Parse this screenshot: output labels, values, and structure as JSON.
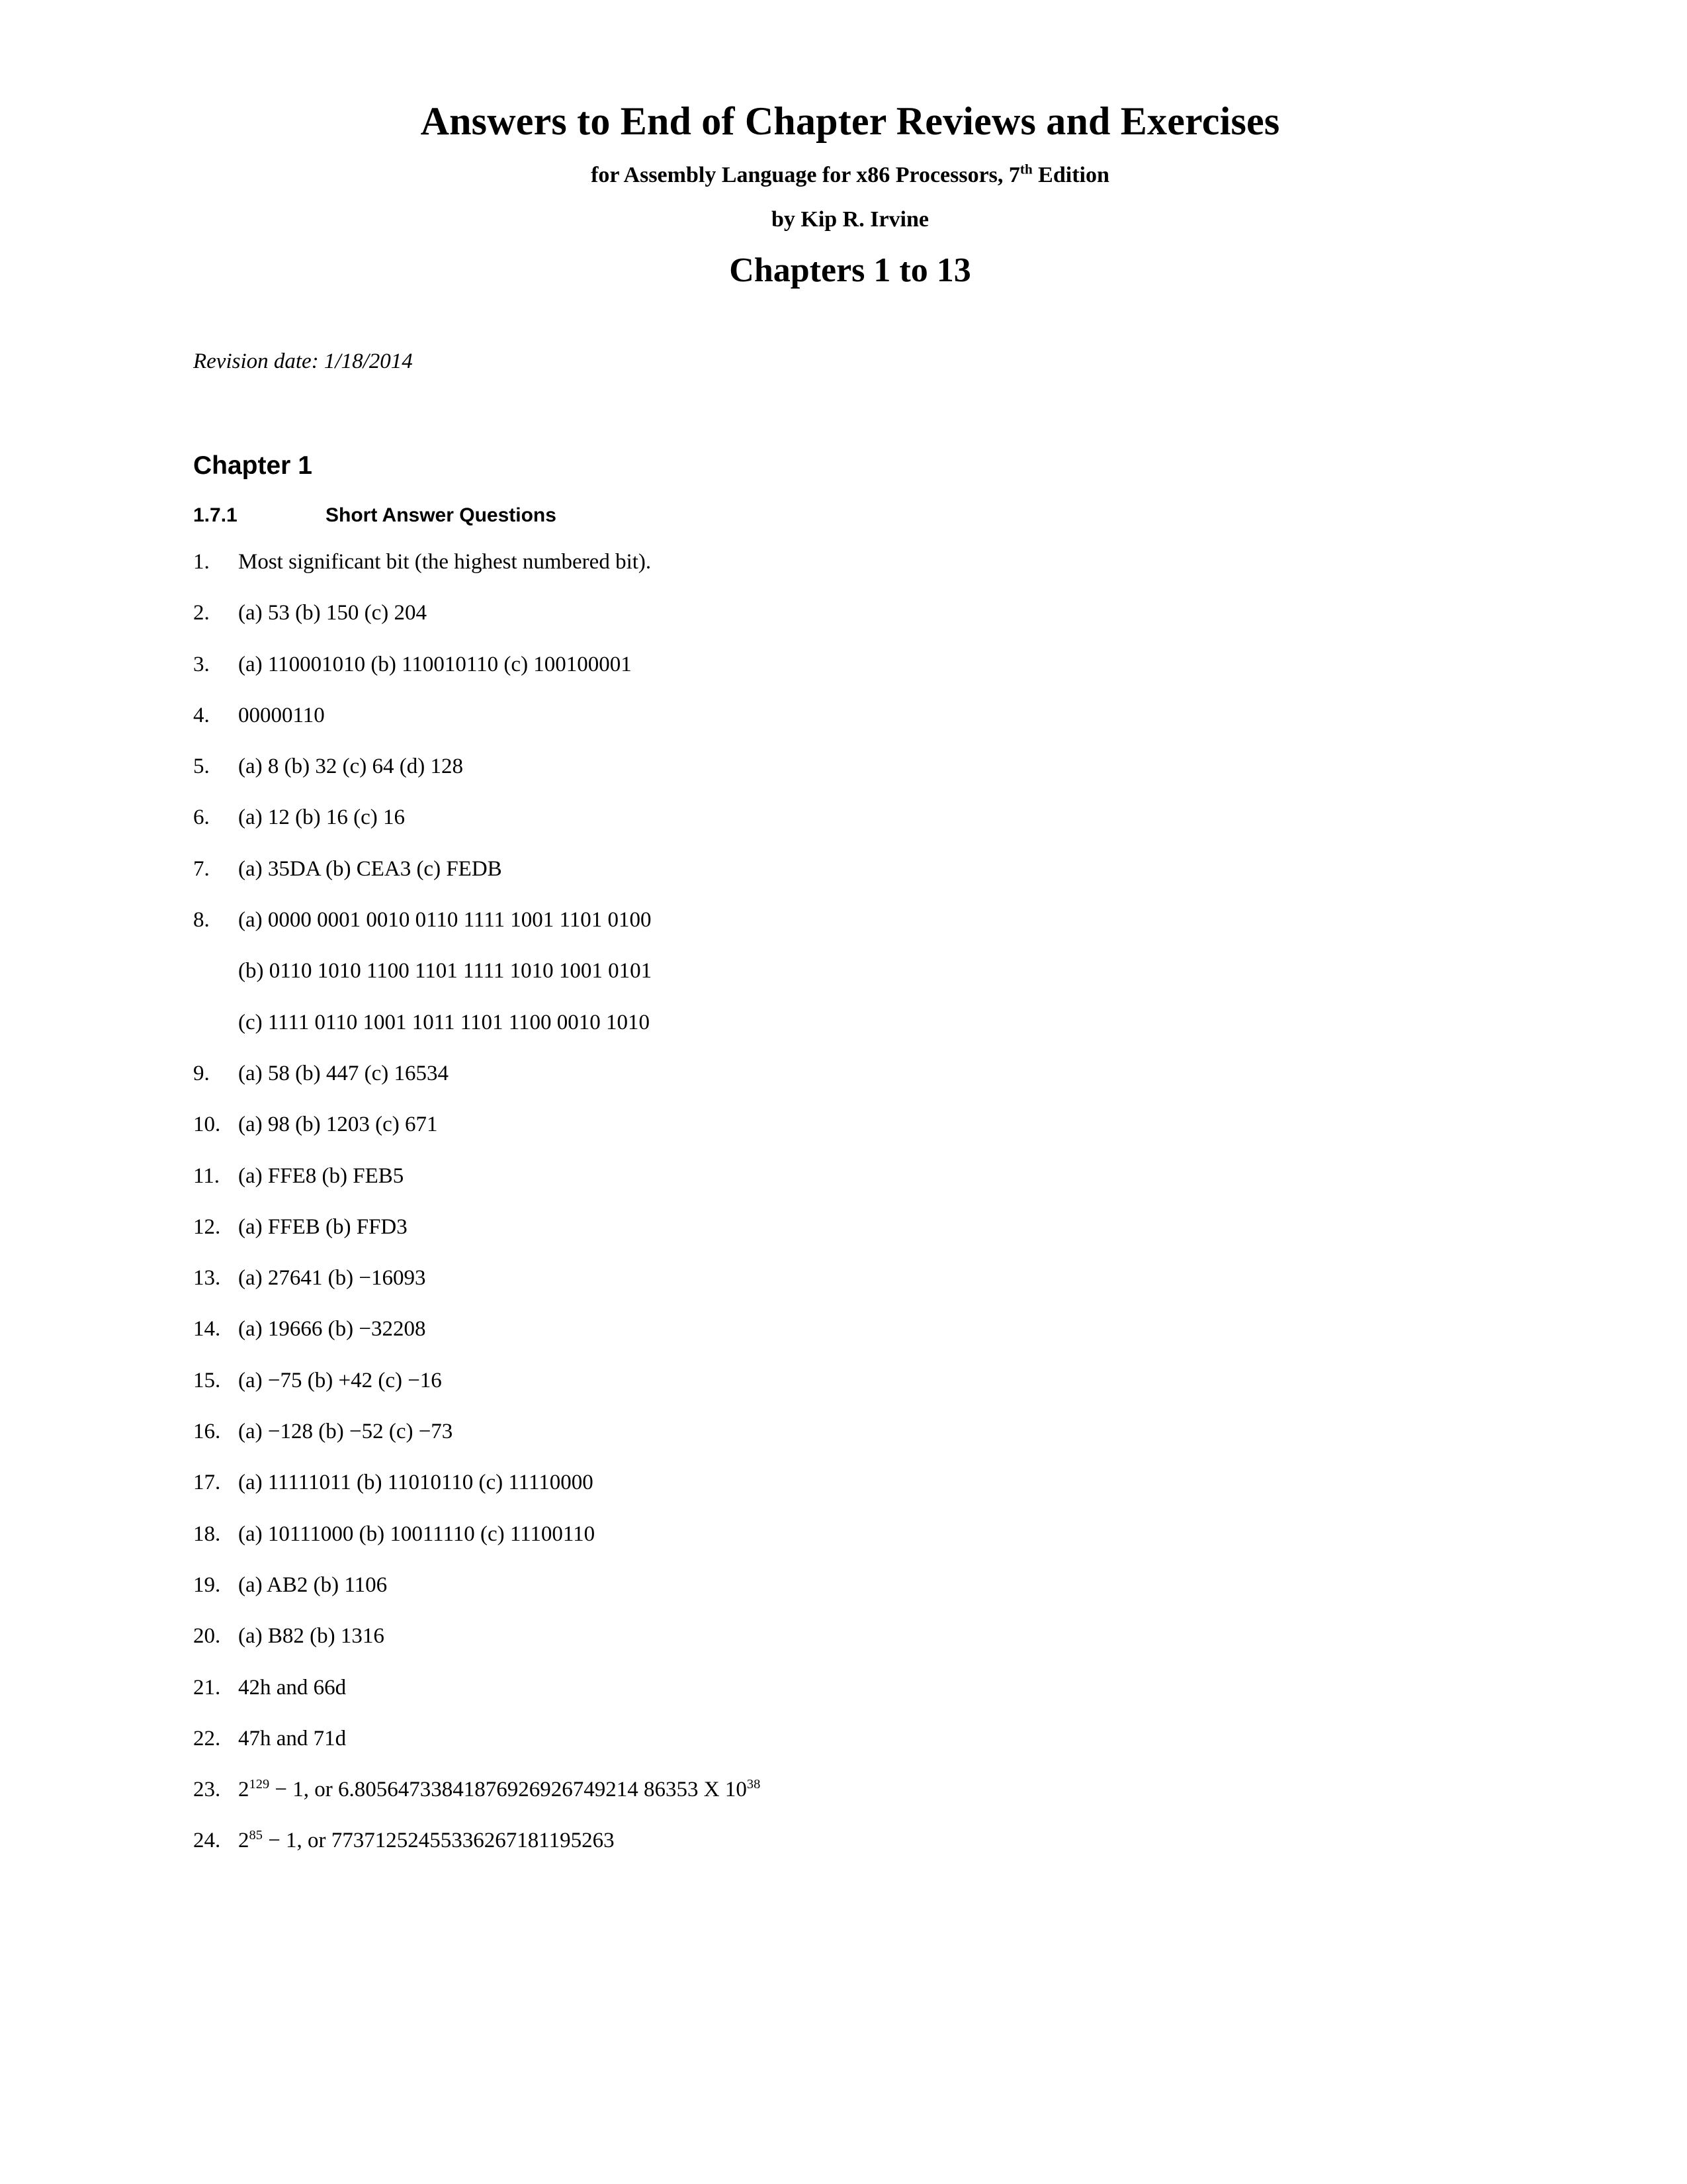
{
  "document": {
    "title": "Answers to End of Chapter Reviews and Exercises",
    "subtitle_before_sup": "for Assembly Language for x86 Processors, 7",
    "subtitle_sup": "th",
    "subtitle_after_sup": " Edition",
    "byline": "by Kip R. Irvine",
    "chapters_range": "Chapters 1 to 13",
    "revision_date": "Revision date: 1/18/2014"
  },
  "headings": {
    "chapter": "Chapter 1",
    "section_number": "1.7.1",
    "section_title": "Short Answer Questions"
  },
  "answers": [
    {
      "num": "1.",
      "text": "Most significant bit (the highest numbered bit)."
    },
    {
      "num": "2.",
      "text": "(a) 53 (b) 150 (c) 204"
    },
    {
      "num": "3.",
      "text": "(a) 110001010 (b) 110010110 (c) 100100001"
    },
    {
      "num": "4.",
      "text": "00000110"
    },
    {
      "num": "5.",
      "text": "(a) 8  (b) 32 (c) 64 (d) 128"
    },
    {
      "num": "6.",
      "text": "(a) 12 (b) 16 (c) 16"
    },
    {
      "num": "7.",
      "text": "(a) 35DA (b) CEA3 (c) FEDB"
    },
    {
      "num": "8.",
      "text": "(a) 0000 0001 0010 0110 1111 1001 1101 0100",
      "continuations": [
        "(b) 0110 1010 1100 1101 1111 1010 1001 0101",
        "(c) 1111 0110 1001 1011 1101 1100 0010 1010"
      ]
    },
    {
      "num": "9.",
      "text": "(a) 58 (b) 447 (c) 16534"
    },
    {
      "num": "10.",
      "text": "(a) 98 (b) 1203 (c) 671"
    },
    {
      "num": "11.",
      "text": "(a) FFE8 (b) FEB5"
    },
    {
      "num": "12.",
      "text": "(a) FFEB (b) FFD3"
    },
    {
      "num": "13.",
      "text": "(a) 27641  (b) −16093"
    },
    {
      "num": "14.",
      "text": "(a) 19666  (b) −32208"
    },
    {
      "num": "15.",
      "text": "(a) −75 (b) +42 (c) −16"
    },
    {
      "num": "16.",
      "text": "(a) −128 (b) −52 (c) −73"
    },
    {
      "num": "17.",
      "text": "(a) 11111011 (b) 11010110 (c) 11110000"
    },
    {
      "num": "18.",
      "text": "(a) 10111000 (b) 10011110 (c) 11100110"
    },
    {
      "num": "19.",
      "text": "(a) AB2  (b) 1106"
    },
    {
      "num": "20.",
      "text": "(a) B82  (b) 1316"
    },
    {
      "num": "21.",
      "text": "42h and 66d"
    },
    {
      "num": "22.",
      "text": "47h and 71d"
    },
    {
      "num": "23.",
      "rich": [
        {
          "t": "2"
        },
        {
          "t": "129",
          "sup": true
        },
        {
          "t": " − 1, or 6.80564733841876926926749214 86353 X 10"
        },
        {
          "t": "38",
          "sup": true
        }
      ]
    },
    {
      "num": "24.",
      "rich": [
        {
          "t": "2"
        },
        {
          "t": "85",
          "sup": true
        },
        {
          "t": " − 1, or 77371252455336267181195263"
        }
      ]
    }
  ]
}
